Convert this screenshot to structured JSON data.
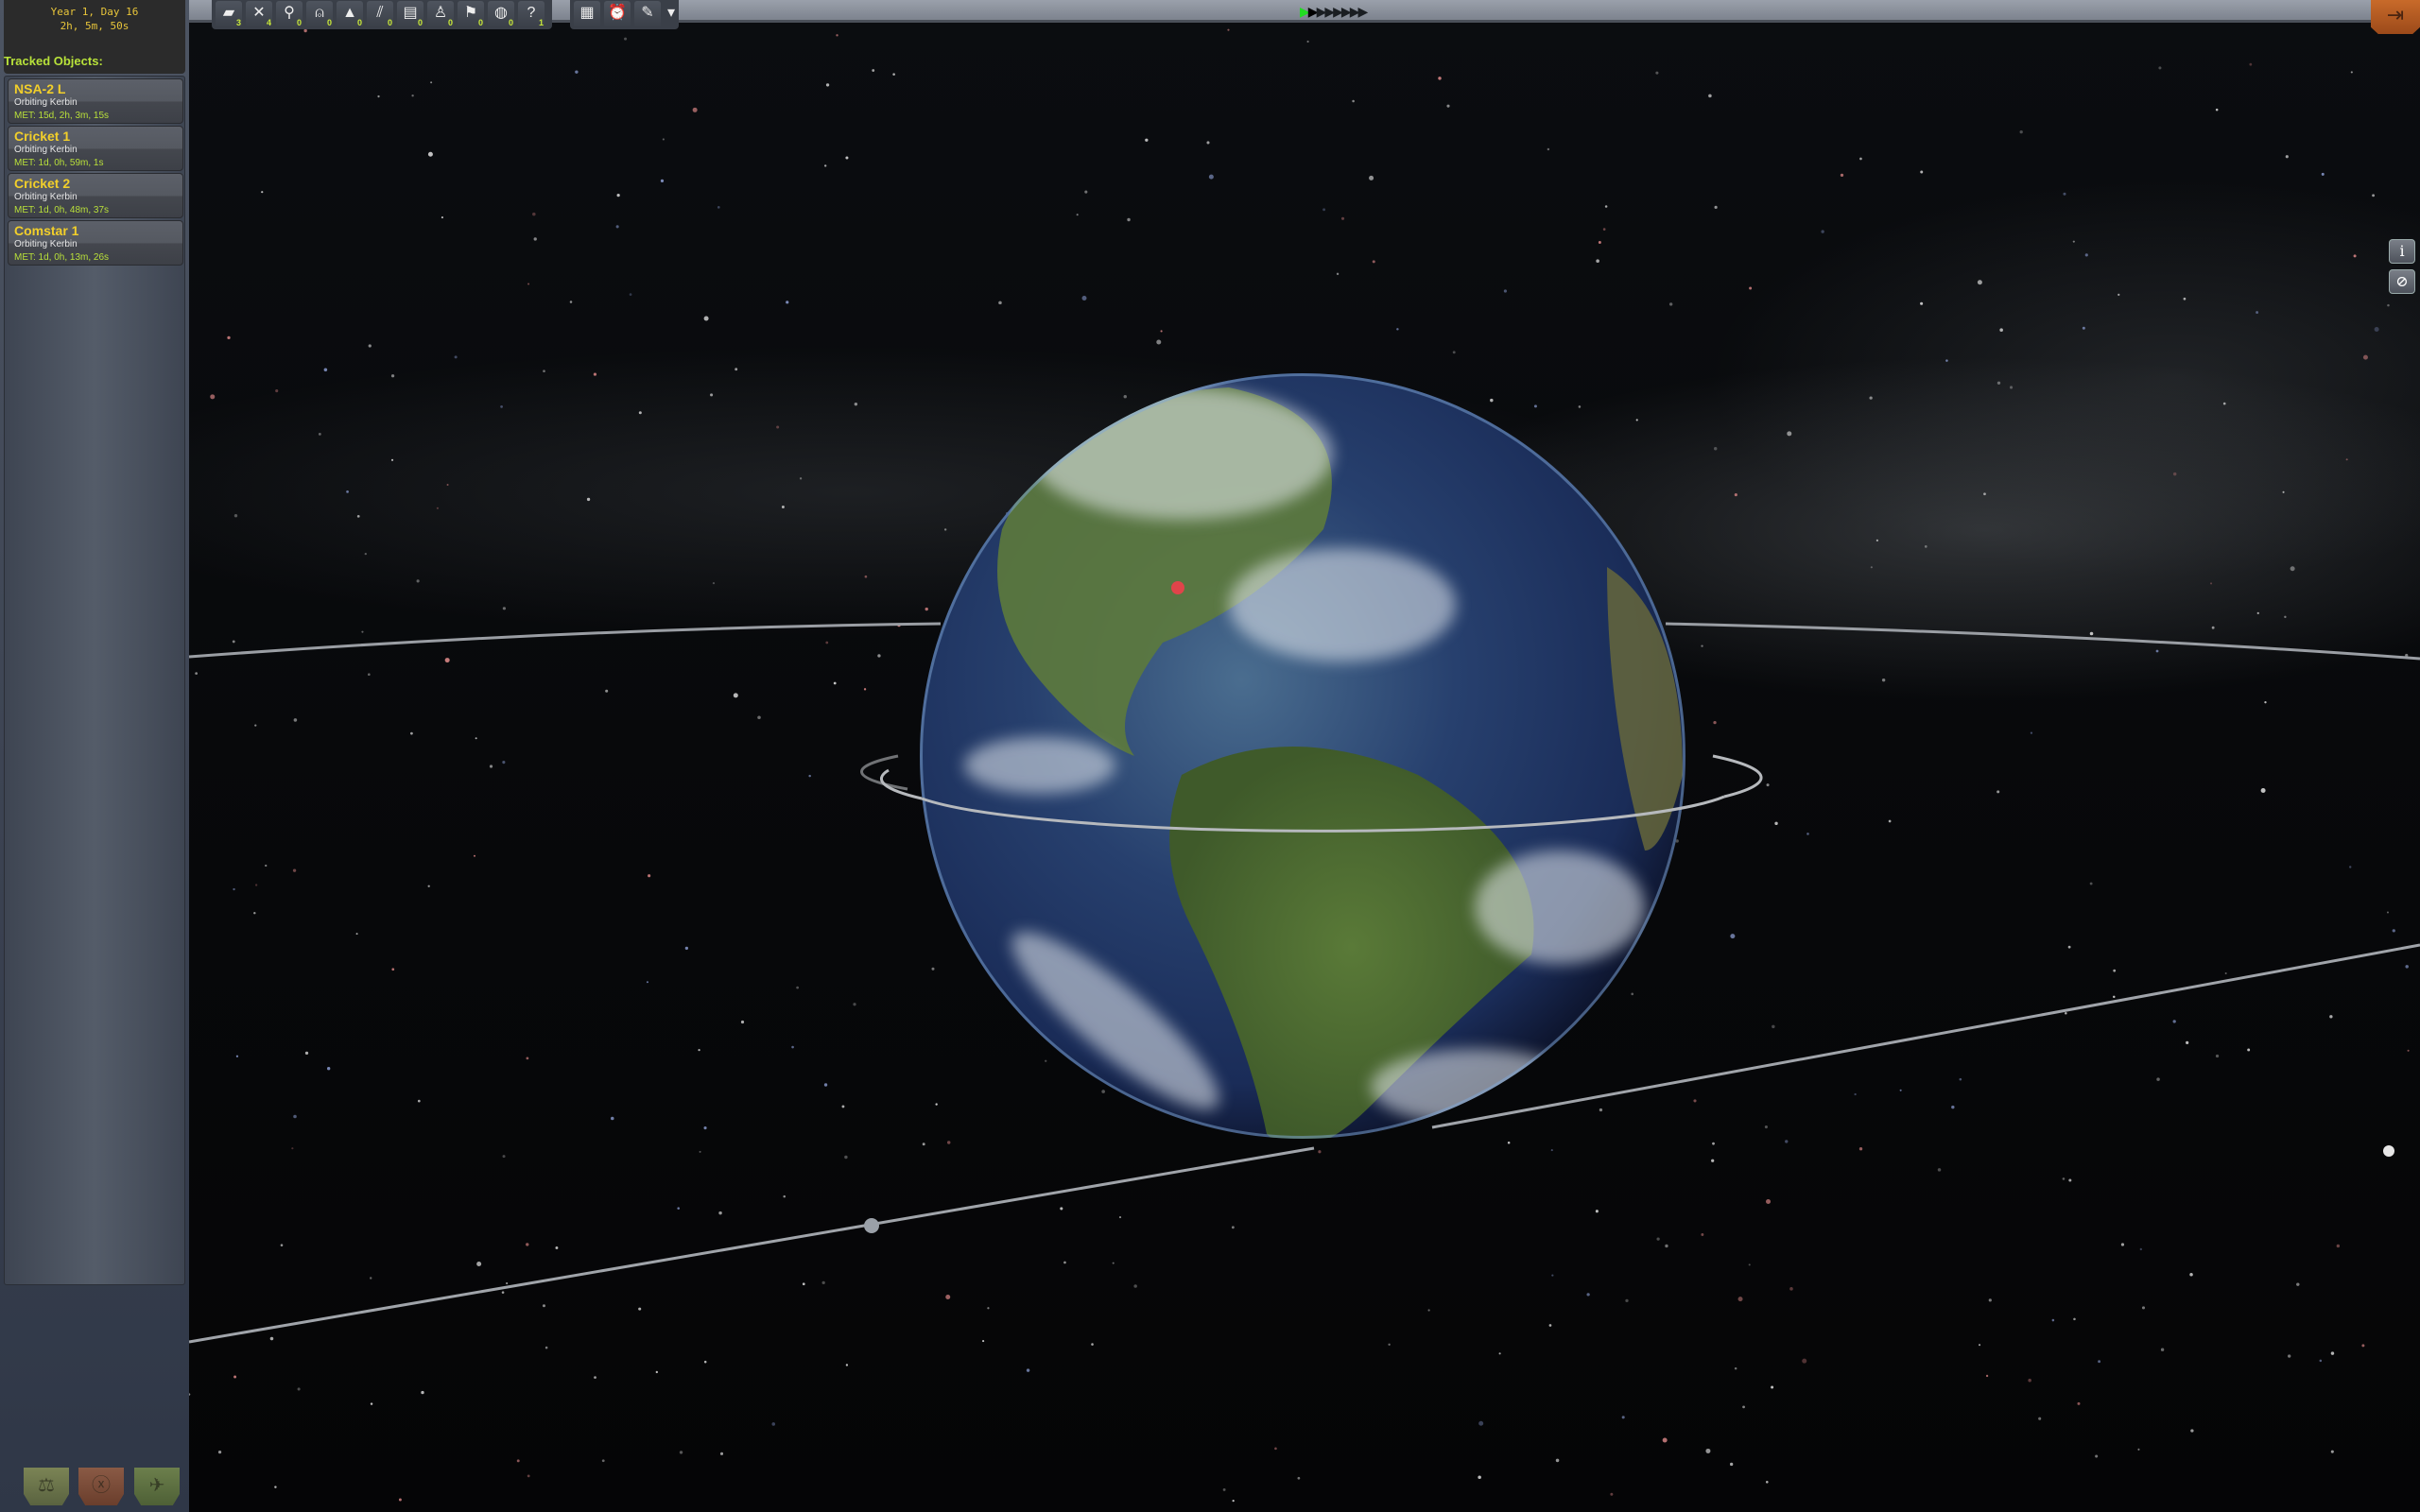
{
  "clock": {
    "date": "Year 1, Day 16",
    "time": "2h, 5m, 50s"
  },
  "tracked_title": "Tracked Objects:",
  "tracked": [
    {
      "name": "NSA-2 L",
      "status": "Orbiting Kerbin",
      "met": "MET: 15d, 2h, 3m, 15s"
    },
    {
      "name": "Cricket 1",
      "status": "Orbiting Kerbin",
      "met": "MET: 1d, 0h, 59m, 1s"
    },
    {
      "name": "Cricket 2",
      "status": "Orbiting Kerbin",
      "met": "MET: 1d, 0h, 48m, 37s"
    },
    {
      "name": "Comstar 1",
      "status": "Orbiting Kerbin",
      "met": "MET: 1d, 0h, 13m, 26s"
    }
  ],
  "filters": [
    {
      "icon": "debris-icon",
      "glyph": "▰",
      "count": "3"
    },
    {
      "icon": "probe-icon",
      "glyph": "✕",
      "count": "4"
    },
    {
      "icon": "rover-icon",
      "glyph": "⚲",
      "count": "0"
    },
    {
      "icon": "lander-icon",
      "glyph": "⍝",
      "count": "0"
    },
    {
      "icon": "ship-icon",
      "glyph": "▲",
      "count": "0"
    },
    {
      "icon": "station-icon",
      "glyph": "⫽",
      "count": "0"
    },
    {
      "icon": "base-icon",
      "glyph": "▤",
      "count": "0"
    },
    {
      "icon": "eva-icon",
      "glyph": "♙",
      "count": "0"
    },
    {
      "icon": "flag-icon",
      "glyph": "⚑",
      "count": "0"
    },
    {
      "icon": "asteroid-icon",
      "glyph": "◍",
      "count": "0"
    },
    {
      "icon": "unknown-icon",
      "glyph": "?",
      "count": "1"
    }
  ],
  "tools": [
    {
      "icon": "calculator-icon",
      "glyph": "▦"
    },
    {
      "icon": "alarm-clock-icon",
      "glyph": "⏰"
    },
    {
      "icon": "notes-icon",
      "glyph": "✎"
    }
  ],
  "timewarp": {
    "level": 1,
    "steps": 8,
    "active_color": "#22dd22"
  },
  "colors": {
    "accent": "#f2cf2a",
    "met": "#b9e03a",
    "exit": "#c86a2a"
  }
}
